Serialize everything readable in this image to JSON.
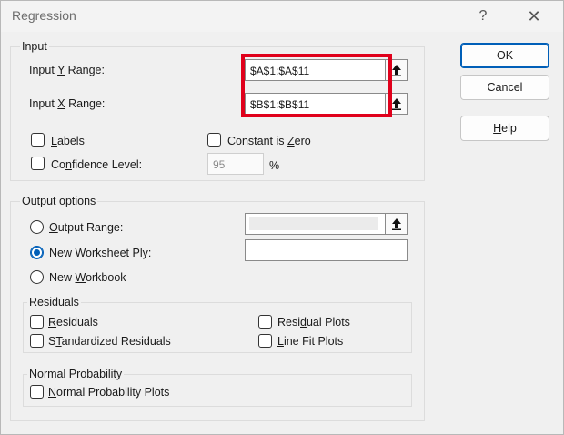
{
  "window": {
    "title": "Regression"
  },
  "titlebar": {
    "help_glyph": "?",
    "close_glyph": "✕"
  },
  "input": {
    "legend": "Input",
    "y_range": {
      "label_pre": "Input ",
      "label_key": "Y",
      "label_post": " Range:",
      "value": "$A$1:$A$11"
    },
    "x_range": {
      "label_pre": "Input ",
      "label_key": "X",
      "label_post": " Range:",
      "value": "$B$1:$B$11"
    },
    "labels": {
      "key": "L",
      "rest": "abels",
      "checked": false
    },
    "constant_is_zero": {
      "pre": "Constant is ",
      "key": "Z",
      "rest": "ero",
      "checked": false
    },
    "confidence": {
      "pre": "Co",
      "key": "n",
      "rest": "fidence Level:",
      "value": "95",
      "unit": "%",
      "checked": false
    }
  },
  "output": {
    "legend": "Output options",
    "output_range": {
      "key": "O",
      "rest": "utput Range:",
      "selected": false
    },
    "new_ply": {
      "pre": "New Worksheet ",
      "key": "P",
      "rest": "ly:",
      "selected": true
    },
    "new_workbook": {
      "pre": "New ",
      "key": "W",
      "rest": "orkbook",
      "selected": false
    }
  },
  "residuals": {
    "legend": "Residuals",
    "residuals": {
      "key": "R",
      "rest": "esiduals"
    },
    "standardized": {
      "key": "T",
      "pre": "S",
      "rest": "andardized Residuals"
    },
    "residual_plots": {
      "pre": "Resi",
      "key": "d",
      "rest": "ual Plots"
    },
    "line_fit": {
      "key": "I",
      "rest": "ine Fit Plots",
      "pre": "L"
    }
  },
  "normal": {
    "legend": "Normal Probability",
    "plots": {
      "key": "N",
      "rest": "ormal Probability Plots"
    }
  },
  "buttons": {
    "ok": "OK",
    "cancel": "Cancel",
    "help": {
      "key": "H",
      "rest": "elp"
    }
  },
  "colors": {
    "highlight": "#e0001b",
    "accent": "#005fb8"
  },
  "icons": {
    "collapse": "collapse-dialog-icon"
  }
}
